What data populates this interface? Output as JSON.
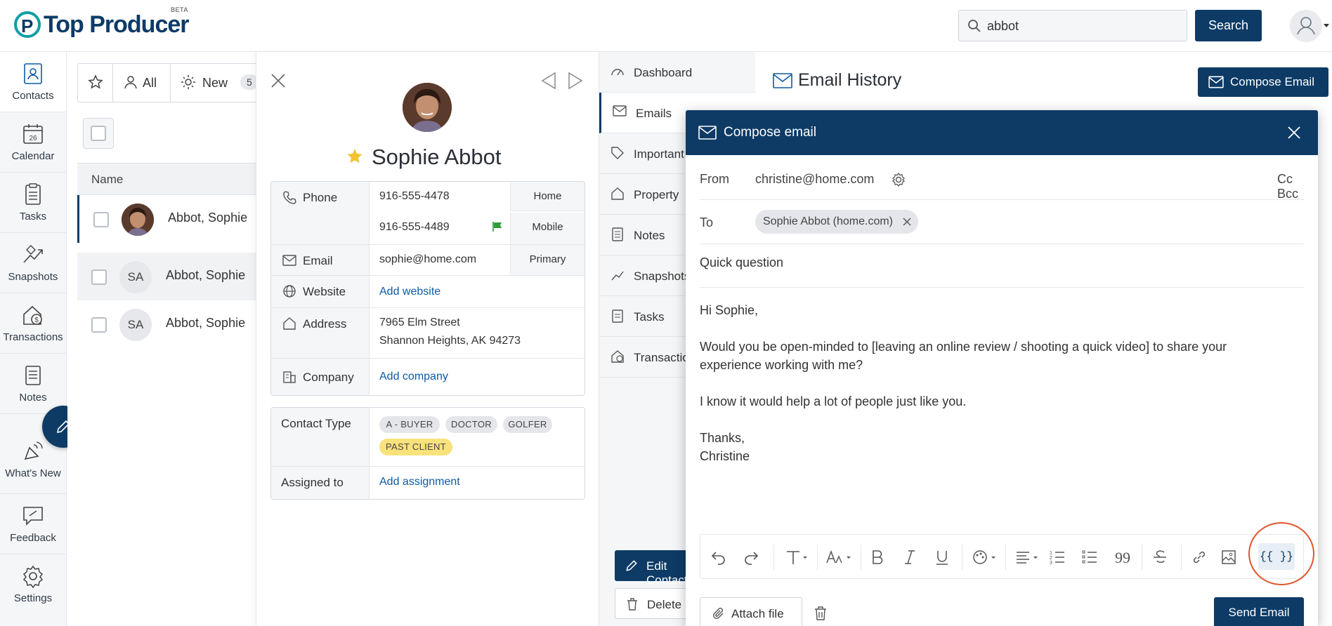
{
  "header": {
    "logo_text": "Top Producer",
    "logo_mark": "P",
    "logo_badge": "BETA",
    "search_value": "abbot",
    "search_button": "Search"
  },
  "leftnav": {
    "items": [
      {
        "label": "Contacts",
        "icon": "contacts-icon"
      },
      {
        "label": "Calendar",
        "icon": "calendar-icon",
        "badge": "26"
      },
      {
        "label": "Tasks",
        "icon": "tasks-icon"
      },
      {
        "label": "Snapshots",
        "icon": "snapshots-icon"
      },
      {
        "label": "Transactions",
        "icon": "transactions-icon"
      },
      {
        "label": "Notes",
        "icon": "notes-icon"
      },
      {
        "label": "What's New",
        "icon": "whats-new-icon"
      },
      {
        "label": "Feedback",
        "icon": "feedback-icon"
      },
      {
        "label": "Settings",
        "icon": "settings-icon"
      }
    ]
  },
  "list": {
    "filters": {
      "all": "All",
      "new": "New",
      "new_count": "5"
    },
    "column_header": "Name",
    "rows": [
      {
        "initials": "",
        "name": "Abbot, Sophie"
      },
      {
        "initials": "SA",
        "name": "Abbot, Sophie"
      },
      {
        "initials": "SA",
        "name": "Abbot, Sophie"
      }
    ]
  },
  "contact": {
    "name": "Sophie Abbot",
    "phone_label": "Phone",
    "phones": [
      {
        "number": "916-555-4478",
        "type": "Home"
      },
      {
        "number": "916-555-4489",
        "type": "Mobile"
      }
    ],
    "email_label": "Email",
    "email": "sophie@home.com",
    "email_type": "Primary",
    "website_label": "Website",
    "website": "Add website",
    "address_label": "Address",
    "address_line1": "7965 Elm Street",
    "address_line2": "Shannon Heights, AK 94273",
    "company_label": "Company",
    "company": "Add company",
    "contact_type_label": "Contact Type",
    "contact_types": [
      "A - BUYER",
      "DOCTOR",
      "GOLFER",
      "PAST CLIENT"
    ],
    "assigned_label": "Assigned to",
    "assigned": "Add assignment"
  },
  "sections": {
    "items": [
      "Dashboard",
      "Emails",
      "Important",
      "Property",
      "Notes",
      "Snapshots",
      "Tasks",
      "Transactions"
    ],
    "edit_button": "Edit Contact",
    "delete_button": "Delete"
  },
  "email_history": {
    "title": "Email History",
    "compose_button": "Compose Email"
  },
  "compose": {
    "title": "Compose email",
    "from_label": "From",
    "from_value": "christine@home.com",
    "cc_bcc": "Cc Bcc",
    "to_label": "To",
    "to_recipient": "Sophie Abbot (home.com)",
    "subject": "Quick question",
    "body": {
      "greeting": "Hi Sophie,",
      "para1": "Would you be open-minded to [leaving an online review / shooting a quick video] to share your experience working with me?",
      "para2": "I know it would help a lot of people just like you.",
      "signoff": "Thanks,",
      "signature": "Christine"
    },
    "merge_fields_label": "{{ }}",
    "attach_label": "Attach file",
    "send_label": "Send Email"
  },
  "colors": {
    "primary": "#0d3b66",
    "highlight_circle": "#e0572e",
    "flag": "#2e9e3a",
    "star": "#f2c230",
    "past_client_chip": "#f9e27c"
  }
}
